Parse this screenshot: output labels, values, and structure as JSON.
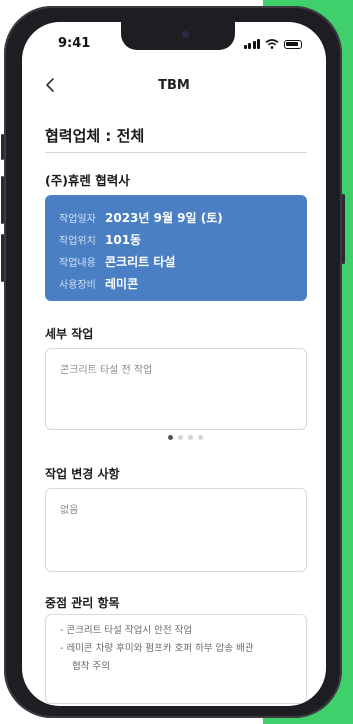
{
  "status_bar": {
    "time": "9:41"
  },
  "nav": {
    "title": "TBM"
  },
  "main": {
    "heading": "협력업체 : 전체",
    "partner_name": "(주)휴렌 협력사",
    "info": [
      {
        "label": "작업일자",
        "value": "2023년 9월 9일 (토)"
      },
      {
        "label": "작업위치",
        "value": "101동"
      },
      {
        "label": "작업내용",
        "value": "콘크리트 타설"
      },
      {
        "label": "사용장비",
        "value": "레미콘"
      }
    ]
  },
  "detail_work": {
    "title": "세부 작업",
    "text": "콘크리트 타설 전 작업",
    "pagination": {
      "total": 4,
      "active": 1
    }
  },
  "changes": {
    "title": "작업 변경 사항",
    "text": "없음"
  },
  "focus_items": {
    "title": "중점 관리 항목",
    "lines": [
      "- 콘크리트 타설 작업시 안전 작업",
      "- 레미콘 차량 후미와 펌프카 호퍼 하부 압송 배관",
      "협착 주의"
    ]
  },
  "colors": {
    "card_blue": "#4a7fc4",
    "background_green": "#3fcf6b"
  }
}
